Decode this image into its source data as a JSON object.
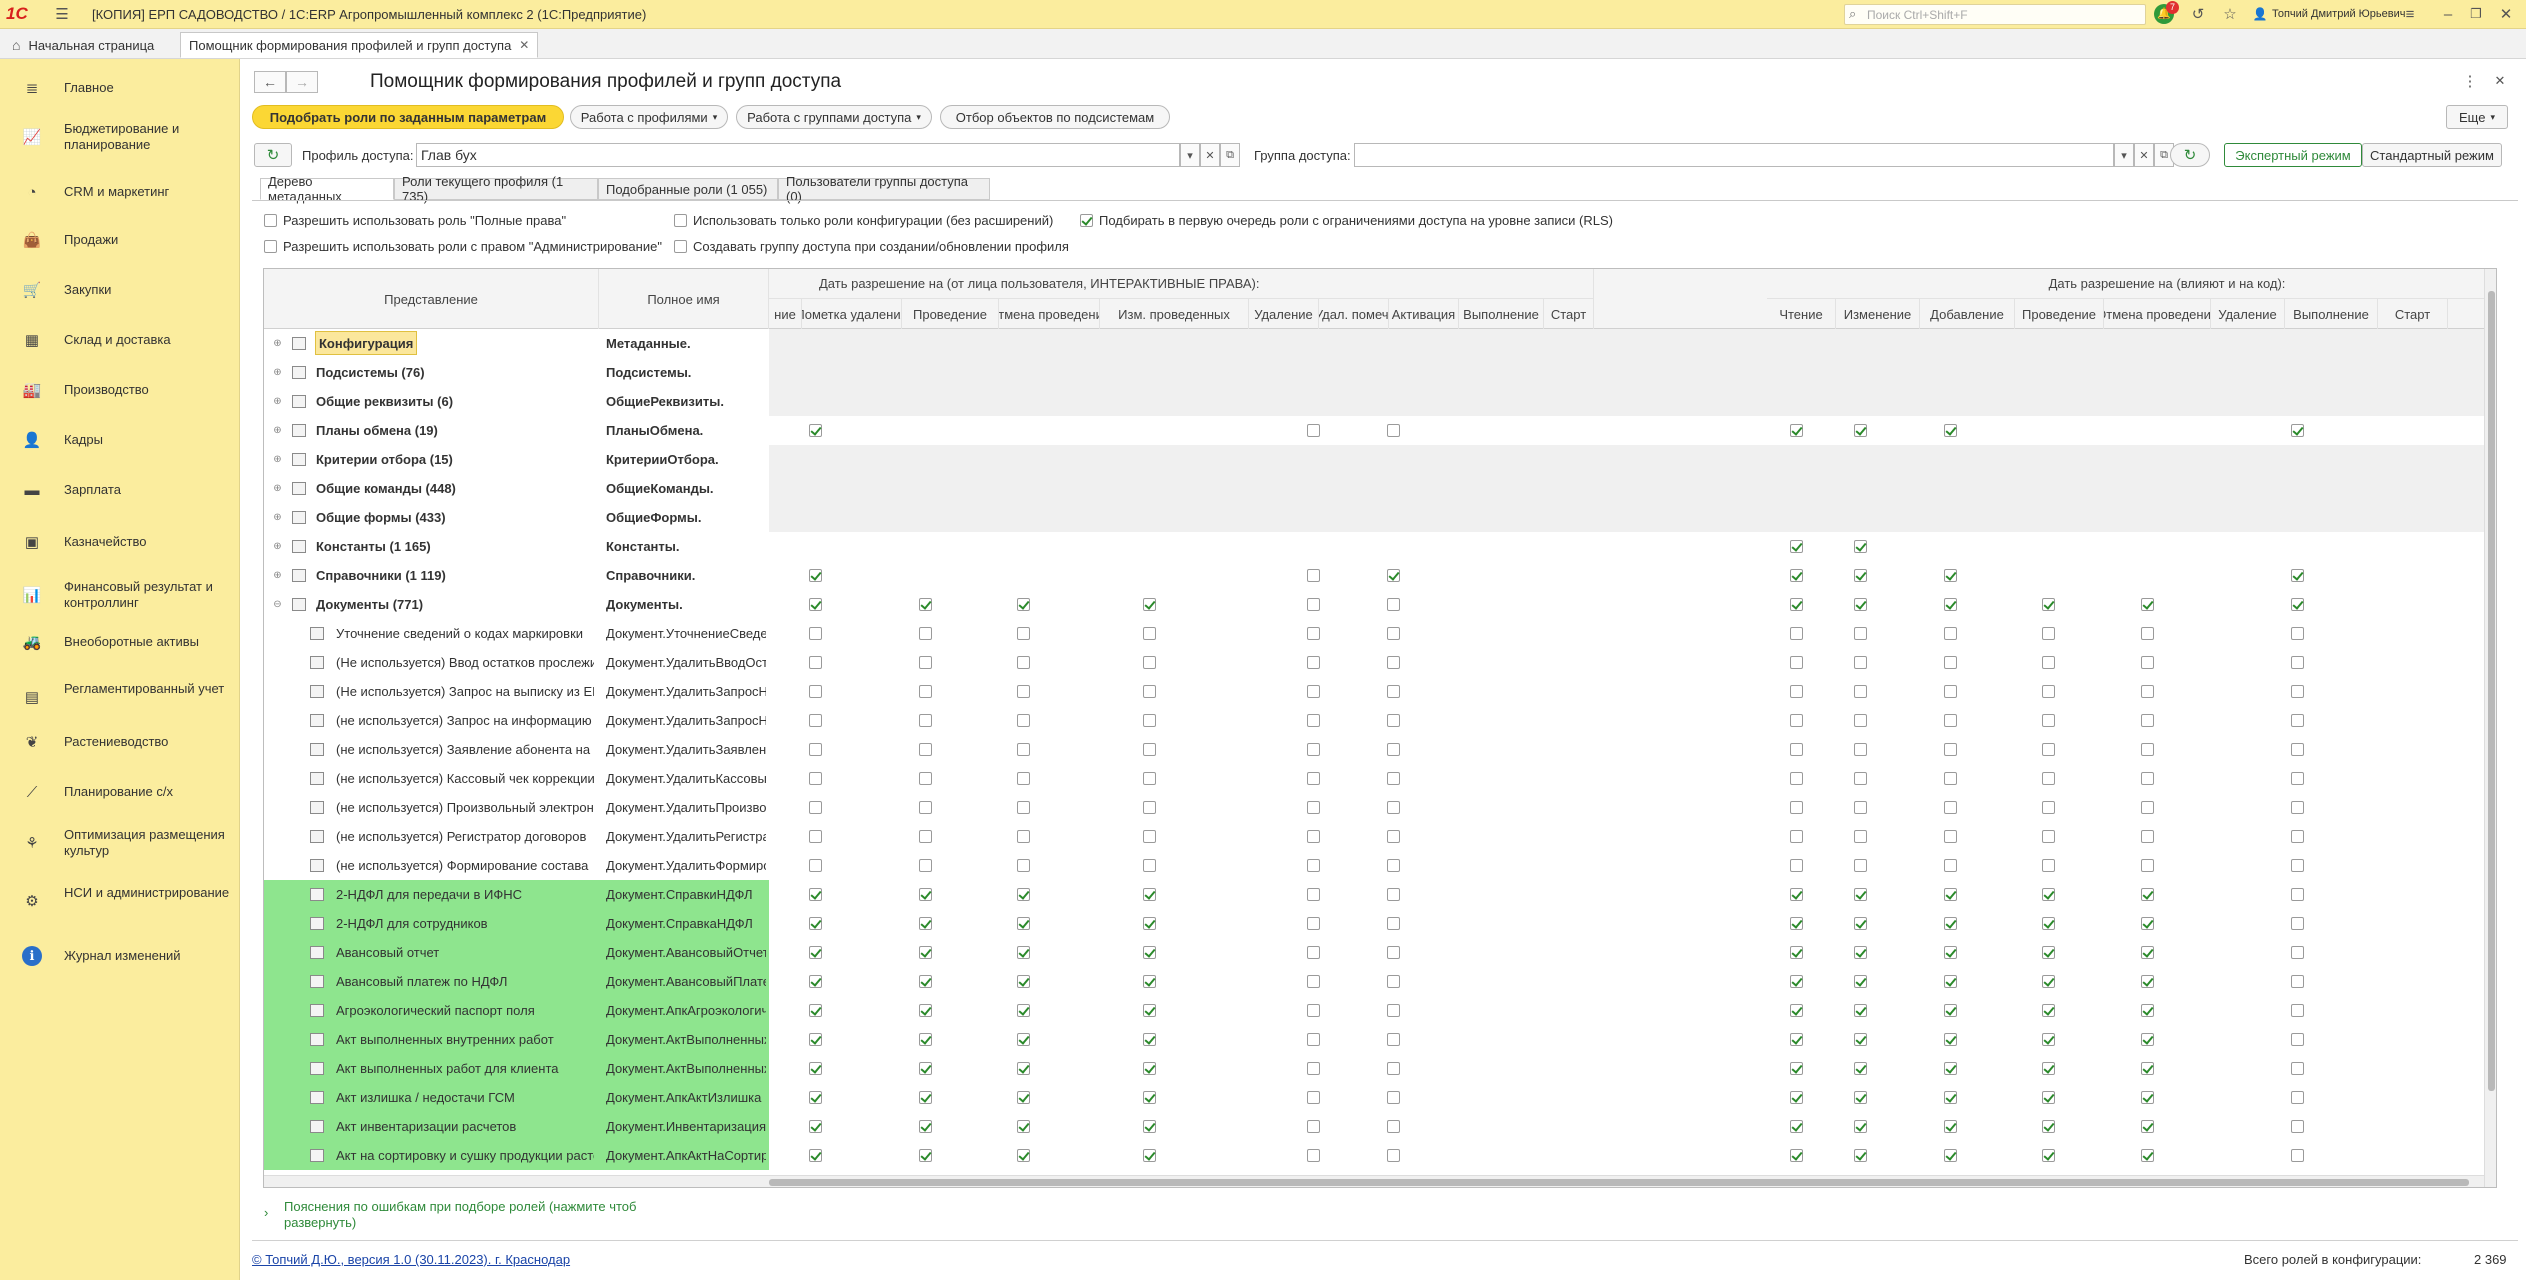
{
  "titlebar": {
    "title": "[КОПИЯ] ЕРП САДОВОДСТВО / 1С:ERP Агропромышленный комплекс 2  (1С:Предприятие)",
    "search_placeholder": "Поиск Ctrl+Shift+F",
    "notifications_count": "7",
    "user": "Топчий Дмитрий Юрьевич"
  },
  "tabs": {
    "home": "Начальная страница",
    "current": "Помощник формирования профилей и групп доступа"
  },
  "sidebar": {
    "items": [
      {
        "label": "Главное",
        "icon": "menu-lines-icon"
      },
      {
        "label": "Бюджетирование и планирование",
        "icon": "chart-icon"
      },
      {
        "label": "CRM и маркетинг",
        "icon": "pie-chart-icon"
      },
      {
        "label": "Продажи",
        "icon": "bag-icon"
      },
      {
        "label": "Закупки",
        "icon": "cart-icon"
      },
      {
        "label": "Склад и доставка",
        "icon": "grid-icon"
      },
      {
        "label": "Производство",
        "icon": "factory-icon"
      },
      {
        "label": "Кадры",
        "icon": "person-icon"
      },
      {
        "label": "Зарплата",
        "icon": "wallet-icon"
      },
      {
        "label": "Казначейство",
        "icon": "safe-icon"
      },
      {
        "label": "Финансовый результат и контроллинг",
        "icon": "bar-chart-icon"
      },
      {
        "label": "Внеоборотные активы",
        "icon": "car-icon"
      },
      {
        "label": "Регламентированный учет",
        "icon": "ledger-icon"
      },
      {
        "label": "Растениеводство",
        "icon": "plant-icon"
      },
      {
        "label": "Планирование с/х",
        "icon": "plan-chart-icon"
      },
      {
        "label": "Оптимизация размещения культур",
        "icon": "seedling-icon"
      },
      {
        "label": "НСИ и администрирование",
        "icon": "gear-icon"
      },
      {
        "label": "Журнал изменений",
        "icon": "info-icon"
      }
    ]
  },
  "form": {
    "title": "Помощник формирования профилей и групп доступа",
    "btn_pick_roles": "Подобрать роли по заданным параметрам",
    "btn_profiles": "Работа с профилями",
    "btn_groups": "Работа с группами доступа",
    "btn_filter": "Отбор объектов  по подсистемам",
    "btn_more": "Еще",
    "profile_label": "Профиль доступа:",
    "profile_value": "Глав бух",
    "group_label": "Группа доступа:",
    "group_value": "",
    "btn_expert": "Экспертный режим",
    "btn_standard": "Стандартный режим"
  },
  "inner_tabs": [
    "Дерево метаданных",
    "Роли текущего профиля (1 735)",
    "Подобранные роли (1 055)",
    "Пользователи группы доступа (0)"
  ],
  "options": {
    "opt1": "Разрешить использовать роль \"Полные права\"",
    "opt2": "Разрешить использовать роли с правом \"Администрирование\"",
    "opt3": "Использовать только роли конфигурации (без расширений)",
    "opt4": "Создавать группу доступа при создании/обновлении профиля",
    "opt5": "Подбирать в первую очередь роли с ограничениями доступа на уровне записи (RLS)"
  },
  "grid": {
    "col_presentation": "Представление",
    "col_fullname": "Полное имя",
    "group1": "Дать разрешение на (от лица пользователя, ИНТЕРАКТИВНЫЕ ПРАВА):",
    "group2": "Дать разрешение на (влияют и на код):",
    "g1_cols": [
      "ние",
      "Пометка удаления",
      "Проведение",
      "Отмена проведения",
      "Изм. проведенных",
      "Удаление",
      "Удал. помеч.",
      "Активация",
      "Выполнение",
      "Старт"
    ],
    "g2_cols": [
      "Чтение",
      "Изменение",
      "Добавление",
      "Проведение",
      "Отмена проведения",
      "Удаление",
      "Выполнение",
      "Старт"
    ],
    "rows": [
      {
        "name": "Конфигурация",
        "full": "Метаданные.",
        "level": 0,
        "bold": true,
        "green": false,
        "selected": true,
        "expand": "+",
        "icon": "config-icon",
        "checks": {}
      },
      {
        "name": "Подсистемы (76)",
        "full": "Подсистемы.",
        "level": 0,
        "bold": true,
        "green": false,
        "expand": "+",
        "icon": "subsystems-icon",
        "checks": {}
      },
      {
        "name": "Общие реквизиты (6)",
        "full": "ОбщиеРеквизиты.",
        "level": 0,
        "bold": true,
        "green": false,
        "expand": "+",
        "icon": "attribute-icon",
        "checks": {}
      },
      {
        "name": "Планы обмена (19)",
        "full": "ПланыОбмена.",
        "level": 0,
        "bold": true,
        "green": false,
        "expand": "+",
        "icon": "exchange-icon",
        "checks": {
          "c1": 1,
          "c5": 0,
          "c6": 0,
          "d0": 1,
          "d1": 1,
          "d2": 1,
          "d5": 1
        }
      },
      {
        "name": "Критерии отбора (15)",
        "full": "КритерииОтбора.",
        "level": 0,
        "bold": true,
        "green": false,
        "expand": "+",
        "icon": "filter-icon",
        "checks": {}
      },
      {
        "name": "Общие команды (448)",
        "full": "ОбщиеКоманды.",
        "level": 0,
        "bold": true,
        "green": false,
        "expand": "+",
        "icon": "command-icon",
        "checks": {}
      },
      {
        "name": "Общие формы (433)",
        "full": "ОбщиеФормы.",
        "level": 0,
        "bold": true,
        "green": false,
        "expand": "+",
        "icon": "form-icon",
        "checks": {}
      },
      {
        "name": "Константы (1 165)",
        "full": "Константы.",
        "level": 0,
        "bold": true,
        "green": false,
        "expand": "+",
        "icon": "constant-icon",
        "checks": {
          "d0": 1,
          "d1": 1
        }
      },
      {
        "name": "Справочники (1 119)",
        "full": "Справочники.",
        "level": 0,
        "bold": true,
        "green": false,
        "expand": "+",
        "icon": "catalog-icon",
        "checks": {
          "c1": 1,
          "c5": 0,
          "c6": 1,
          "d0": 1,
          "d1": 1,
          "d2": 1,
          "d5": 1
        }
      },
      {
        "name": "Документы (771)",
        "full": "Документы.",
        "level": 0,
        "bold": true,
        "green": false,
        "expand": "−",
        "icon": "document-icon",
        "checks": {
          "c1": 1,
          "c2": 1,
          "c3": 1,
          "c4": 1,
          "c5": 0,
          "c6": 0,
          "d0": 1,
          "d1": 1,
          "d2": 1,
          "d3": 1,
          "d4": 1,
          "d5": 1
        }
      },
      {
        "name": "Уточнение сведений о кодах маркировки",
        "full": "Документ.УточнениеСведений",
        "level": 1,
        "bold": false,
        "green": false,
        "checks": {
          "c1": 0,
          "c2": 0,
          "c3": 0,
          "c4": 0,
          "c5": 0,
          "c6": 0,
          "d0": 0,
          "d1": 0,
          "d2": 0,
          "d3": 0,
          "d4": 0,
          "d5": 0
        }
      },
      {
        "name": "(Не используется) Ввод остатков прослеживаемых",
        "full": "Документ.УдалитьВводОстатков",
        "level": 1,
        "bold": false,
        "green": false,
        "checks": {
          "c1": 0,
          "c2": 0,
          "c3": 0,
          "c4": 0,
          "c5": 0,
          "c6": 0,
          "d0": 0,
          "d1": 0,
          "d2": 0,
          "d3": 0,
          "d4": 0,
          "d5": 0
        }
      },
      {
        "name": "(Не используется) Запрос на выписку из ЕГРН",
        "full": "Документ.УдалитьЗапросНаВыписку",
        "level": 1,
        "bold": false,
        "green": false,
        "checks": {
          "c1": 0,
          "c2": 0,
          "c3": 0,
          "c4": 0,
          "c5": 0,
          "c6": 0,
          "d0": 0,
          "d1": 0,
          "d2": 0,
          "d3": 0,
          "d4": 0,
          "d5": 0
        }
      },
      {
        "name": "(не используется) Запрос на информацию",
        "full": "Документ.УдалитьЗапросНаИнформацию",
        "level": 1,
        "bold": false,
        "green": false,
        "checks": {
          "c1": 0,
          "c2": 0,
          "c3": 0,
          "c4": 0,
          "c5": 0,
          "c6": 0,
          "d0": 0,
          "d1": 0,
          "d2": 0,
          "d3": 0,
          "d4": 0,
          "d5": 0
        }
      },
      {
        "name": "(не используется) Заявление абонента на подключение",
        "full": "Документ.УдалитьЗаявлениеАбонента",
        "level": 1,
        "bold": false,
        "green": false,
        "checks": {
          "c1": 0,
          "c2": 0,
          "c3": 0,
          "c4": 0,
          "c5": 0,
          "c6": 0,
          "d0": 0,
          "d1": 0,
          "d2": 0,
          "d3": 0,
          "d4": 0,
          "d5": 0
        }
      },
      {
        "name": "(не используется) Кассовый чек коррекции",
        "full": "Документ.УдалитьКассовыйЧекКоррекции",
        "level": 1,
        "bold": false,
        "green": false,
        "checks": {
          "c1": 0,
          "c2": 0,
          "c3": 0,
          "c4": 0,
          "c5": 0,
          "c6": 0,
          "d0": 0,
          "d1": 0,
          "d2": 0,
          "d3": 0,
          "d4": 0,
          "d5": 0
        }
      },
      {
        "name": "(не используется) Произвольный электронный документ",
        "full": "Документ.УдалитьПроизвольныйЭД",
        "level": 1,
        "bold": false,
        "green": false,
        "checks": {
          "c1": 0,
          "c2": 0,
          "c3": 0,
          "c4": 0,
          "c5": 0,
          "c6": 0,
          "d0": 0,
          "d1": 0,
          "d2": 0,
          "d3": 0,
          "d4": 0,
          "d5": 0
        }
      },
      {
        "name": "(не используется) Регистратор договоров",
        "full": "Документ.УдалитьРегистраторДоговоров",
        "level": 1,
        "bold": false,
        "green": false,
        "checks": {
          "c1": 0,
          "c2": 0,
          "c3": 0,
          "c4": 0,
          "c5": 0,
          "c6": 0,
          "d0": 0,
          "d1": 0,
          "d2": 0,
          "d3": 0,
          "d4": 0,
          "d5": 0
        }
      },
      {
        "name": "(не используется) Формирование состава",
        "full": "Документ.УдалитьФормированиеСостава",
        "level": 1,
        "bold": false,
        "green": false,
        "checks": {
          "c1": 0,
          "c2": 0,
          "c3": 0,
          "c4": 0,
          "c5": 0,
          "c6": 0,
          "d0": 0,
          "d1": 0,
          "d2": 0,
          "d3": 0,
          "d4": 0,
          "d5": 0
        }
      },
      {
        "name": "2-НДФЛ для передачи в ИФНС",
        "full": "Документ.СправкиНДФЛ",
        "level": 1,
        "bold": false,
        "green": true,
        "checks": {
          "c1": 1,
          "c2": 1,
          "c3": 1,
          "c4": 1,
          "c5": 0,
          "c6": 0,
          "d0": 1,
          "d1": 1,
          "d2": 1,
          "d3": 1,
          "d4": 1,
          "d5": 0
        }
      },
      {
        "name": "2-НДФЛ для сотрудников",
        "full": "Документ.СправкаНДФЛ",
        "level": 1,
        "bold": false,
        "green": true,
        "checks": {
          "c1": 1,
          "c2": 1,
          "c3": 1,
          "c4": 1,
          "c5": 0,
          "c6": 0,
          "d0": 1,
          "d1": 1,
          "d2": 1,
          "d3": 1,
          "d4": 1,
          "d5": 0
        }
      },
      {
        "name": "Авансовый отчет",
        "full": "Документ.АвансовыйОтчет",
        "level": 1,
        "bold": false,
        "green": true,
        "checks": {
          "c1": 1,
          "c2": 1,
          "c3": 1,
          "c4": 1,
          "c5": 0,
          "c6": 0,
          "d0": 1,
          "d1": 1,
          "d2": 1,
          "d3": 1,
          "d4": 1,
          "d5": 0
        }
      },
      {
        "name": "Авансовый платеж по НДФЛ",
        "full": "Документ.АвансовыйПлатеж",
        "level": 1,
        "bold": false,
        "green": true,
        "checks": {
          "c1": 1,
          "c2": 1,
          "c3": 1,
          "c4": 1,
          "c5": 0,
          "c6": 0,
          "d0": 1,
          "d1": 1,
          "d2": 1,
          "d3": 1,
          "d4": 1,
          "d5": 0
        }
      },
      {
        "name": "Агроэкологический паспорт поля",
        "full": "Документ.АпкАгроэкологический",
        "level": 1,
        "bold": false,
        "green": true,
        "checks": {
          "c1": 1,
          "c2": 1,
          "c3": 1,
          "c4": 1,
          "c5": 0,
          "c6": 0,
          "d0": 1,
          "d1": 1,
          "d2": 1,
          "d3": 1,
          "d4": 1,
          "d5": 0
        }
      },
      {
        "name": "Акт выполненных внутренних работ",
        "full": "Документ.АктВыполненных",
        "level": 1,
        "bold": false,
        "green": true,
        "checks": {
          "c1": 1,
          "c2": 1,
          "c3": 1,
          "c4": 1,
          "c5": 0,
          "c6": 0,
          "d0": 1,
          "d1": 1,
          "d2": 1,
          "d3": 1,
          "d4": 1,
          "d5": 0
        }
      },
      {
        "name": "Акт выполненных работ для клиента",
        "full": "Документ.АктВыполненных",
        "level": 1,
        "bold": false,
        "green": true,
        "checks": {
          "c1": 1,
          "c2": 1,
          "c3": 1,
          "c4": 1,
          "c5": 0,
          "c6": 0,
          "d0": 1,
          "d1": 1,
          "d2": 1,
          "d3": 1,
          "d4": 1,
          "d5": 0
        }
      },
      {
        "name": "Акт излишка / недостачи ГСМ",
        "full": "Документ.АпкАктИзлишка",
        "level": 1,
        "bold": false,
        "green": true,
        "checks": {
          "c1": 1,
          "c2": 1,
          "c3": 1,
          "c4": 1,
          "c5": 0,
          "c6": 0,
          "d0": 1,
          "d1": 1,
          "d2": 1,
          "d3": 1,
          "d4": 1,
          "d5": 0
        }
      },
      {
        "name": "Акт инвентаризации расчетов",
        "full": "Документ.Инвентаризация",
        "level": 1,
        "bold": false,
        "green": true,
        "checks": {
          "c1": 1,
          "c2": 1,
          "c3": 1,
          "c4": 1,
          "c5": 0,
          "c6": 0,
          "d0": 1,
          "d1": 1,
          "d2": 1,
          "d3": 1,
          "d4": 1,
          "d5": 0
        }
      },
      {
        "name": "Акт на сортировку и сушку продукции растениеводства",
        "full": "Документ.АпкАктНаСортировку",
        "level": 1,
        "bold": false,
        "green": true,
        "checks": {
          "c1": 1,
          "c2": 1,
          "c3": 1,
          "c4": 1,
          "c5": 0,
          "c6": 0,
          "d0": 1,
          "d1": 1,
          "d2": 1,
          "d3": 1,
          "d4": 1,
          "d5": 0
        }
      }
    ]
  },
  "errors_link": "Пояснения по ошибкам при подборе ролей (нажмите чтоб развернуть)",
  "footer": {
    "copyright": "© Топчий Д.Ю., версия 1.0 (30.11.2023). г. Краснодар",
    "total_label": "Всего ролей в конфигурации:",
    "total_value": "2 369"
  },
  "colors": {
    "yellow_panel": "#fbed9e",
    "green_row": "#8ee58e",
    "accent_button": "#fbd734",
    "expert_green": "#2f8a3a"
  }
}
